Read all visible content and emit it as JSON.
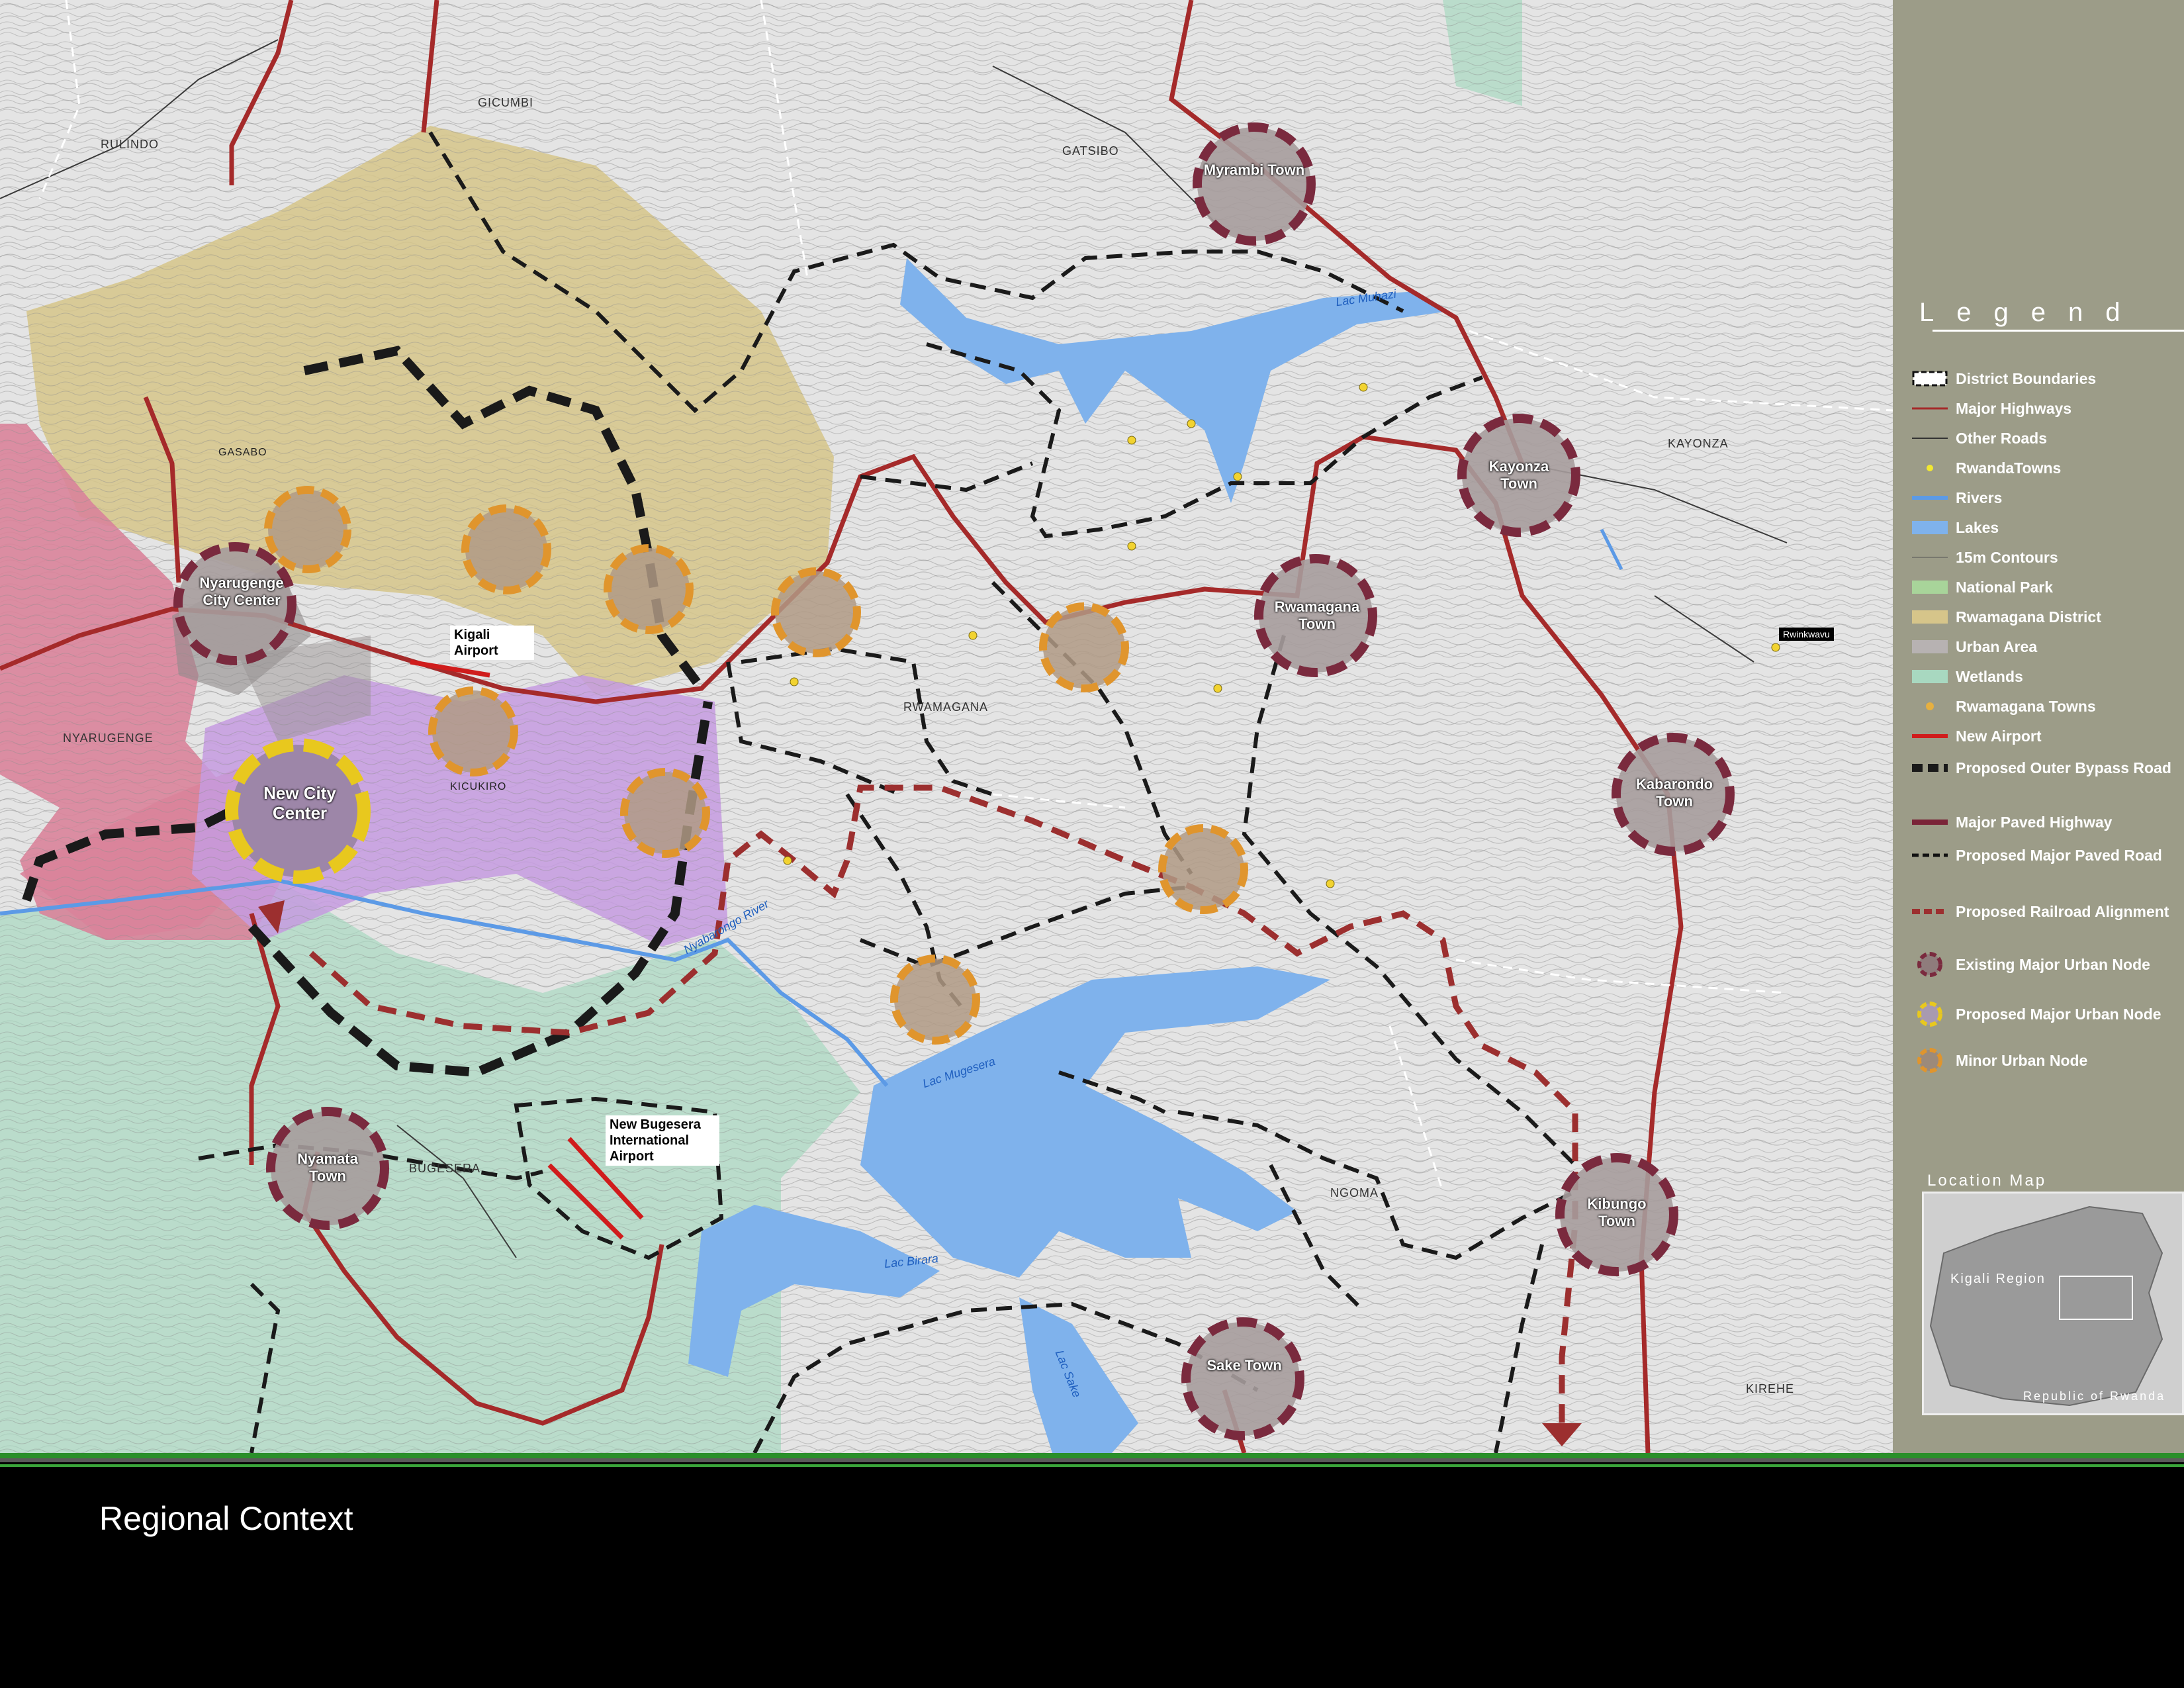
{
  "title": "Regional Context",
  "map": {
    "districts": [
      "GICUMBI",
      "RULINDO",
      "GATSIBO",
      "KAYONZA",
      "RWAMAGANA",
      "NYARUGENGE",
      "BUGESERA",
      "NGOMA",
      "KIREHE",
      "KICUKIRO",
      "GASABO"
    ],
    "water": [
      "Lac Muhazi",
      "Nyabarongo River",
      "Lac Mugesera",
      "Lac Birara",
      "Lac Sake"
    ],
    "town_tags": [
      "Rwinkwavu"
    ],
    "existing_nodes": [
      {
        "name": "Myrambi Town"
      },
      {
        "name": "Kayonza Town"
      },
      {
        "name": "Rwamagana Town"
      },
      {
        "name": "Kabarondo Town"
      },
      {
        "name": "Kibungo Town"
      },
      {
        "name": "Sake Town"
      },
      {
        "name": "Nyamata Town"
      },
      {
        "name": "Nyarugenge City Center"
      }
    ],
    "proposed_major_node": {
      "name": "New City Center"
    },
    "callouts": {
      "kigali_airport": "Kigali Airport",
      "bugesera_airport": "New Bugesera International Airport"
    }
  },
  "legend": {
    "title": "Legend",
    "items": [
      {
        "label": "District Boundaries",
        "icon": "district-boundary"
      },
      {
        "label": "Major Highways",
        "icon": "major-highway"
      },
      {
        "label": "Other Roads",
        "icon": "other-road"
      },
      {
        "label": "RwandaTowns",
        "icon": "town-dot"
      },
      {
        "label": "Rivers",
        "icon": "river"
      },
      {
        "label": "Lakes",
        "icon": "lake"
      },
      {
        "label": "15m Contours",
        "icon": "contour"
      },
      {
        "label": "National Park",
        "icon": "national-park"
      },
      {
        "label": "Rwamagana District",
        "icon": "rwamagana-district"
      },
      {
        "label": "Urban Area",
        "icon": "urban-area"
      },
      {
        "label": "Wetlands",
        "icon": "wetland"
      },
      {
        "label": "Rwamagana Towns",
        "icon": "rwamagana-town"
      },
      {
        "label": "New Airport",
        "icon": "new-airport"
      },
      {
        "label": "Proposed Outer Bypass Road",
        "icon": "outer-bypass"
      },
      {
        "label": "Major Paved Highway",
        "icon": "paved-highway"
      },
      {
        "label": "Proposed Major Paved Road",
        "icon": "proposed-paved-road"
      },
      {
        "label": "Proposed Railroad Alignment",
        "icon": "railroad"
      },
      {
        "label": "Existing Major Urban Node",
        "icon": "existing-node"
      },
      {
        "label": "Proposed Major Urban Node",
        "icon": "proposed-major-node"
      },
      {
        "label": "Minor Urban Node",
        "icon": "minor-node"
      }
    ]
  },
  "location_map": {
    "title": "Location Map",
    "region_label": "Kigali Region",
    "country_label": "Republic of Rwanda"
  },
  "colors": {
    "highway": "#a52a2a",
    "paved_highway": "#7a2438",
    "railroad": "#9c2f2f",
    "river": "#5c9ae6",
    "lake": "#7fb2ec",
    "rwamagana": "#d6c58a",
    "urban": "#b7b2b2",
    "wetland": "#a8d8c0",
    "park": "#a8d49a",
    "pink_district": "#d9839a",
    "purple_district": "#c59be0",
    "node_existing": "#7a2a3e",
    "node_proposed": "#e8c81e",
    "node_minor": "#e0952d",
    "panel": "#9c9c88"
  }
}
